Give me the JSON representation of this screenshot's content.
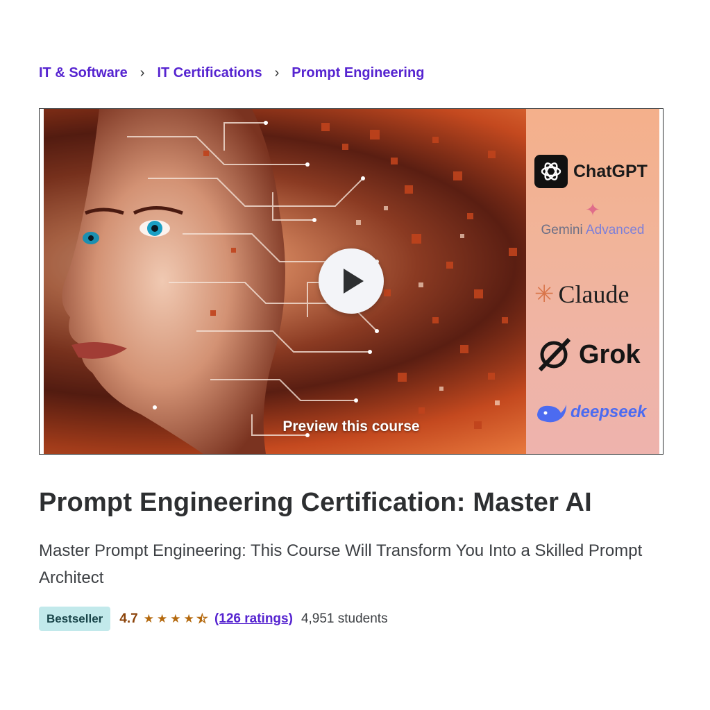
{
  "breadcrumb": {
    "items": [
      {
        "label": "IT & Software"
      },
      {
        "label": "IT Certifications"
      },
      {
        "label": "Prompt Engineering"
      }
    ],
    "separator": "›"
  },
  "preview": {
    "label": "Preview this course",
    "logos": {
      "chatgpt": "ChatGPT",
      "gemini_1": "Gemini",
      "gemini_2": "Advanced",
      "claude": "Claude",
      "grok": "Grok",
      "deepseek": "deepseek"
    },
    "play_icon": "play-icon"
  },
  "course": {
    "title": "Prompt Engineering Certification: Master AI",
    "subtitle": "Master Prompt Engineering: This Course Will Transform You Into a Skilled Prompt Architect",
    "badge": "Bestseller",
    "rating": "4.7",
    "stars_value": 4.5,
    "stars_max": 5,
    "ratings_text": "(126 ratings)",
    "students_text": "4,951 students"
  },
  "colors": {
    "link": "#5624d0",
    "badge_bg": "#c2e9eb",
    "rating": "#8b4309",
    "star": "#b4690e"
  }
}
